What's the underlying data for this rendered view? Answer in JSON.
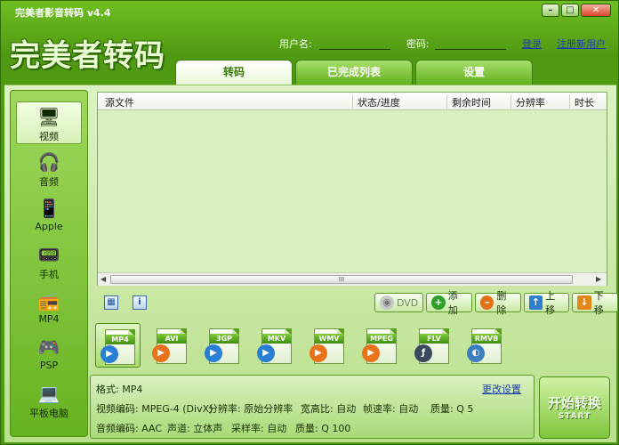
{
  "window": {
    "title": "完美者影音转码 v4.4",
    "minimize": "–",
    "restore": "□",
    "close": "✕"
  },
  "logo": {
    "text": "完美者转码"
  },
  "login": {
    "username_label": "用户名:",
    "password_label": "密码:",
    "login_link": "登录",
    "register_link": "注册新用户"
  },
  "tabs": [
    {
      "label": "转码",
      "active": true
    },
    {
      "label": "已完成列表",
      "active": false
    },
    {
      "label": "设置",
      "active": false
    }
  ],
  "sidebar": {
    "items": [
      {
        "label": "视频",
        "icon": "monitor-icon",
        "glyph": "🖥",
        "active": true
      },
      {
        "label": "音频",
        "icon": "headphones-icon",
        "glyph": "🎧",
        "active": false
      },
      {
        "label": "Apple",
        "icon": "iphone-icon",
        "glyph": "📱",
        "active": false
      },
      {
        "label": "手机",
        "icon": "mobile-phone-icon",
        "glyph": "📟",
        "active": false
      },
      {
        "label": "MP4",
        "icon": "mp4-player-icon",
        "glyph": "📻",
        "active": false
      },
      {
        "label": "PSP",
        "icon": "psp-icon",
        "glyph": "🎮",
        "active": false
      },
      {
        "label": "平板电脑",
        "icon": "tablet-icon",
        "glyph": "💻",
        "active": false
      }
    ]
  },
  "table": {
    "columns": [
      "源文件",
      "状态/进度",
      "剩余时间",
      "分辨率",
      "时长"
    ],
    "rows": [],
    "scroll_thumb": "III"
  },
  "tools": {
    "add_folder_icon": "add-folder-icon",
    "info_icon": "info-icon",
    "info_glyph": "i"
  },
  "actions": {
    "dvd": "DVD",
    "add": "添加",
    "delete": "删除",
    "move_up": "上移",
    "move_down": "下移"
  },
  "formats": [
    {
      "label": "MP4",
      "active": true,
      "badge": "▶",
      "color": "#2a7fd4"
    },
    {
      "label": "AVI",
      "active": false,
      "badge": "▶",
      "color": "#e8731a"
    },
    {
      "label": "3GP",
      "active": false,
      "badge": "▶",
      "color": "#2a7fd4"
    },
    {
      "label": "MKV",
      "active": false,
      "badge": "▶",
      "color": "#2a7fd4"
    },
    {
      "label": "WMV",
      "active": false,
      "badge": "▶",
      "color": "#e8731a"
    },
    {
      "label": "MPEG",
      "active": false,
      "badge": "▶",
      "color": "#e8731a"
    },
    {
      "label": "FLV",
      "active": false,
      "badge": "ƒ",
      "color": "#3a4a5c"
    },
    {
      "label": "RMVB",
      "active": false,
      "badge": "◐",
      "color": "#3a7fc0"
    }
  ],
  "info": {
    "format": "格式: MP4",
    "change_settings": "更改设置",
    "video_codec": "视频编码: MPEG-4 (DivX)",
    "video_resolution": "分辨率: 原始分辨率",
    "video_aspect": "宽高比: 自动",
    "video_fps": "帧速率: 自动",
    "video_quality": "质量: Q 5",
    "audio_codec": "音频编码: AAC",
    "audio_channel": "声道: 立体声",
    "audio_samplerate": "采样率: 自动",
    "audio_quality": "质量: Q 100"
  },
  "start_button": {
    "line1": "开始转换",
    "line2": "START"
  }
}
